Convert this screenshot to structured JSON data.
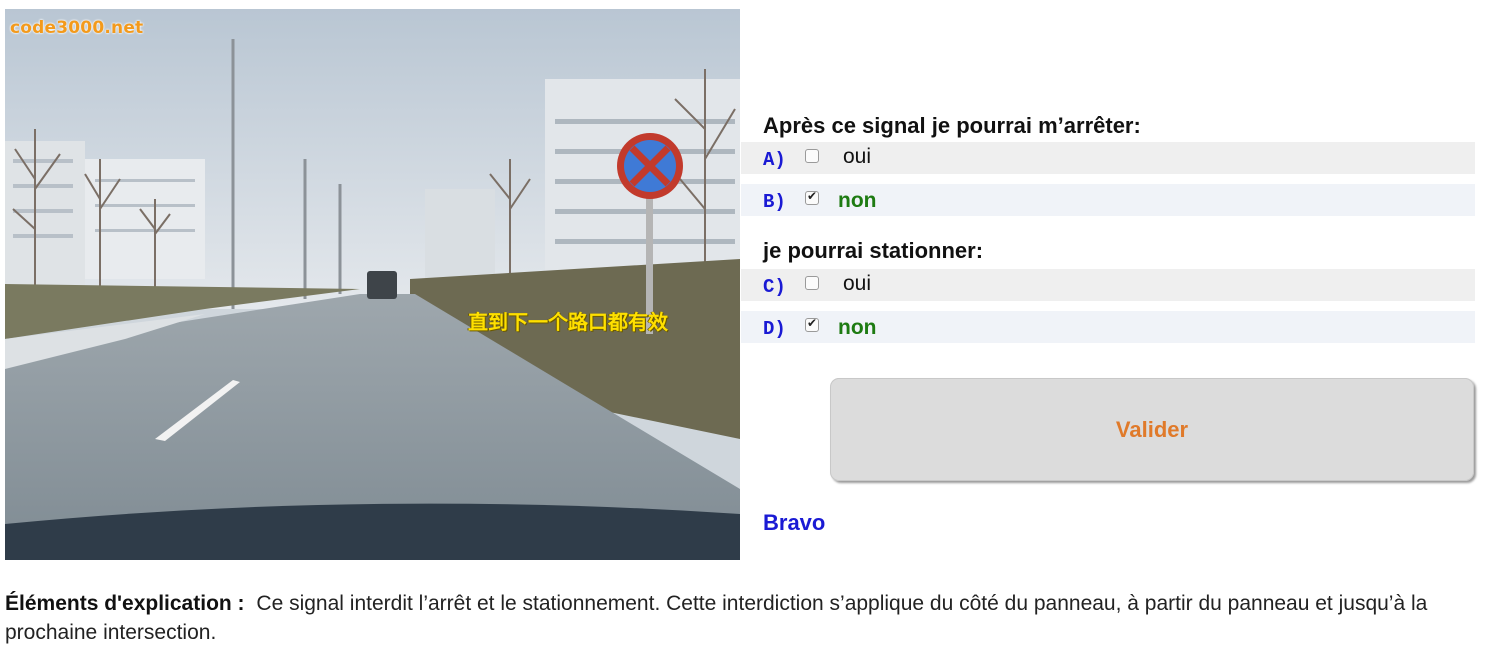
{
  "image": {
    "watermark": "code3000.net",
    "caption": "直到下一个路口都有效"
  },
  "questions": [
    {
      "title": "Après ce signal je pourrai m’arrêter:",
      "options": [
        {
          "letter": "A)",
          "label": "oui",
          "checked": false
        },
        {
          "letter": "B)",
          "label": "non",
          "checked": true
        }
      ]
    },
    {
      "title": "je pourrai stationner:",
      "options": [
        {
          "letter": "C)",
          "label": "oui",
          "checked": false
        },
        {
          "letter": "D)",
          "label": "non",
          "checked": true
        }
      ]
    }
  ],
  "submit_label": "Valider",
  "result": "Bravo",
  "explanation": {
    "heading": "Éléments d'explication :",
    "text": "Ce signal interdit l’arrêt et le stationnement. Cette interdiction s’applique du côté du panneau, à partir du panneau et jusqu’à la prochaine intersection."
  }
}
